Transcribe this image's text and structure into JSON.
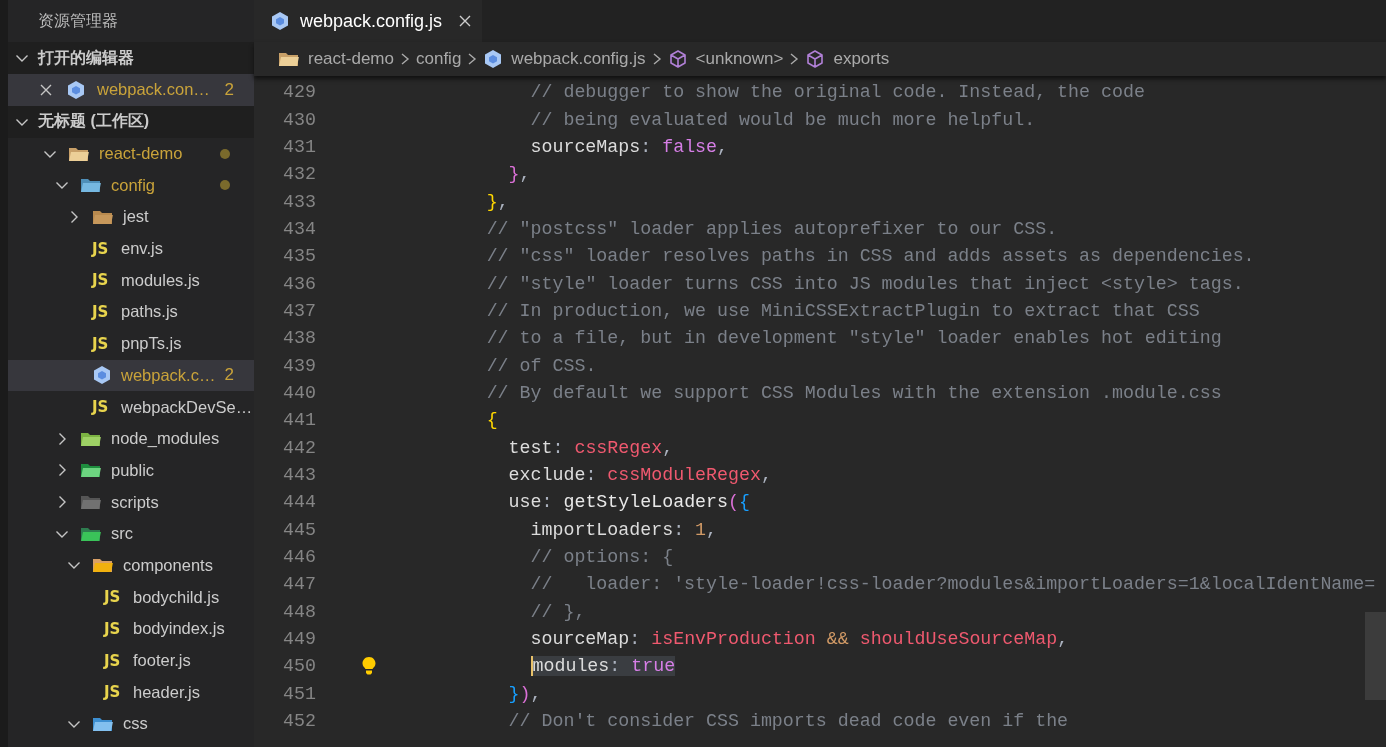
{
  "sidebar": {
    "title": "资源管理器",
    "sections": [
      {
        "kind": "open-editors",
        "title": "打开的编辑器",
        "expanded": true,
        "items": [
          {
            "label": "webpack.con…",
            "kind": "webpack",
            "selected": true,
            "modified": true,
            "badge": "2"
          }
        ]
      },
      {
        "kind": "tree",
        "title": "无标题 (工作区)",
        "expanded": true,
        "items": [
          {
            "label": "react-demo",
            "kind": "folder-react",
            "expanded": true,
            "selected": false,
            "modified": true,
            "children": [
              {
                "label": "config",
                "kind": "folder-config",
                "expanded": true,
                "selected": false,
                "modified": true,
                "children": [
                  {
                    "label": "jest",
                    "kind": "folder",
                    "expanded": false,
                    "selected": false,
                    "modified": false
                  },
                  {
                    "label": "env.js",
                    "kind": "js",
                    "icon_label": "JS",
                    "selected": false,
                    "modified": false
                  },
                  {
                    "label": "modules.js",
                    "kind": "js",
                    "icon_label": "JS",
                    "selected": false,
                    "modified": false
                  },
                  {
                    "label": "paths.js",
                    "kind": "js",
                    "icon_label": "JS",
                    "selected": false,
                    "modified": false
                  },
                  {
                    "label": "pnpTs.js",
                    "kind": "js",
                    "icon_label": "JS",
                    "selected": false,
                    "modified": false
                  },
                  {
                    "label": "webpack.c…",
                    "kind": "webpack",
                    "selected": true,
                    "modified": true,
                    "badge": "2"
                  },
                  {
                    "label": "webpackDevSe…",
                    "kind": "js",
                    "icon_label": "JS",
                    "selected": false,
                    "modified": false
                  }
                ]
              },
              {
                "label": "node_modules",
                "kind": "folder-node",
                "expanded": false,
                "selected": false,
                "modified": false
              },
              {
                "label": "public",
                "kind": "folder-public",
                "expanded": false,
                "selected": false,
                "modified": false
              },
              {
                "label": "scripts",
                "kind": "folder-scripts",
                "expanded": false,
                "selected": false,
                "modified": false
              },
              {
                "label": "src",
                "kind": "folder-src",
                "expanded": true,
                "selected": false,
                "modified": false,
                "children": [
                  {
                    "label": "components",
                    "kind": "folder-components",
                    "expanded": true,
                    "selected": false,
                    "modified": false,
                    "children": [
                      {
                        "label": "bodychild.js",
                        "kind": "js",
                        "icon_label": "JS",
                        "selected": false,
                        "modified": false
                      },
                      {
                        "label": "bodyindex.js",
                        "kind": "js",
                        "icon_label": "JS",
                        "selected": false,
                        "modified": false
                      },
                      {
                        "label": "footer.js",
                        "kind": "js",
                        "icon_label": "JS",
                        "selected": false,
                        "modified": false
                      },
                      {
                        "label": "header.js",
                        "kind": "js",
                        "icon_label": "JS",
                        "selected": false,
                        "modified": false
                      }
                    ]
                  },
                  {
                    "label": "css",
                    "kind": "folder-css",
                    "expanded": true,
                    "selected": false,
                    "modified": false
                  }
                ]
              }
            ]
          }
        ]
      }
    ]
  },
  "tabs": [
    {
      "label": "webpack.config.js",
      "kind": "webpack",
      "selected": true
    }
  ],
  "breadcrumbs": [
    {
      "label": "react-demo",
      "kind": "folder-react"
    },
    {
      "label": "config",
      "kind": "plain"
    },
    {
      "label": "webpack.config.js",
      "kind": "webpack"
    },
    {
      "label": "<unknown>",
      "kind": "symbol"
    },
    {
      "label": "exports",
      "kind": "symbol"
    }
  ],
  "editor": {
    "lines": [
      {
        "number": "429",
        "current": false,
        "tokens": [
          {
            "kind": "comment",
            "text": "                // debugger to show the original code. Instead, the code"
          }
        ]
      },
      {
        "number": "430",
        "current": false,
        "tokens": [
          {
            "kind": "comment",
            "text": "                // being evaluated would be much more helpful."
          }
        ]
      },
      {
        "number": "431",
        "current": false,
        "tokens": [
          {
            "kind": "prop",
            "text": "                sourceMaps"
          },
          {
            "kind": "punct",
            "text": ": "
          },
          {
            "kind": "keyword",
            "text": "false"
          },
          {
            "kind": "punct",
            "text": ","
          }
        ]
      },
      {
        "number": "432",
        "current": false,
        "tokens": [
          {
            "kind": "brace2",
            "text": "              }"
          },
          {
            "kind": "punct",
            "text": ","
          }
        ]
      },
      {
        "number": "433",
        "current": false,
        "tokens": [
          {
            "kind": "brace1",
            "text": "            }"
          },
          {
            "kind": "punct",
            "text": ","
          }
        ]
      },
      {
        "number": "434",
        "current": false,
        "tokens": [
          {
            "kind": "comment",
            "text": "            // \"postcss\" loader applies autoprefixer to our CSS."
          }
        ]
      },
      {
        "number": "435",
        "current": false,
        "tokens": [
          {
            "kind": "comment",
            "text": "            // \"css\" loader resolves paths in CSS and adds assets as dependencies."
          }
        ]
      },
      {
        "number": "436",
        "current": false,
        "tokens": [
          {
            "kind": "comment",
            "text": "            // \"style\" loader turns CSS into JS modules that inject <style> tags."
          }
        ]
      },
      {
        "number": "437",
        "current": false,
        "tokens": [
          {
            "kind": "comment",
            "text": "            // In production, we use MiniCSSExtractPlugin to extract that CSS"
          }
        ]
      },
      {
        "number": "438",
        "current": false,
        "tokens": [
          {
            "kind": "comment",
            "text": "            // to a file, but in development \"style\" loader enables hot editing"
          }
        ]
      },
      {
        "number": "439",
        "current": false,
        "tokens": [
          {
            "kind": "comment",
            "text": "            // of CSS."
          }
        ]
      },
      {
        "number": "440",
        "current": false,
        "tokens": [
          {
            "kind": "comment",
            "text": "            // By default we support CSS Modules with the extension .module.css"
          }
        ]
      },
      {
        "number": "441",
        "current": false,
        "tokens": [
          {
            "kind": "brace1",
            "text": "            {"
          }
        ]
      },
      {
        "number": "442",
        "current": false,
        "tokens": [
          {
            "kind": "prop",
            "text": "              test"
          },
          {
            "kind": "punct",
            "text": ": "
          },
          {
            "kind": "var",
            "text": "cssRegex"
          },
          {
            "kind": "punct",
            "text": ","
          }
        ]
      },
      {
        "number": "443",
        "current": false,
        "tokens": [
          {
            "kind": "prop",
            "text": "              exclude"
          },
          {
            "kind": "punct",
            "text": ": "
          },
          {
            "kind": "var",
            "text": "cssModuleRegex"
          },
          {
            "kind": "punct",
            "text": ","
          }
        ]
      },
      {
        "number": "444",
        "current": false,
        "tokens": [
          {
            "kind": "prop",
            "text": "              use"
          },
          {
            "kind": "punct",
            "text": ": "
          },
          {
            "kind": "func",
            "text": "getStyleLoaders"
          },
          {
            "kind": "brace2",
            "text": "("
          },
          {
            "kind": "brace3",
            "text": "{"
          }
        ]
      },
      {
        "number": "445",
        "current": false,
        "tokens": [
          {
            "kind": "prop",
            "text": "                importLoaders"
          },
          {
            "kind": "punct",
            "text": ": "
          },
          {
            "kind": "num",
            "text": "1"
          },
          {
            "kind": "punct",
            "text": ","
          }
        ]
      },
      {
        "number": "446",
        "current": false,
        "tokens": [
          {
            "kind": "comment",
            "text": "                // options: {"
          }
        ]
      },
      {
        "number": "447",
        "current": false,
        "tokens": [
          {
            "kind": "comment",
            "text": "                //   loader: 'style-loader!css-loader?modules&importLoaders=1&localIdentName="
          }
        ]
      },
      {
        "number": "448",
        "current": false,
        "tokens": [
          {
            "kind": "comment",
            "text": "                // },"
          }
        ]
      },
      {
        "number": "449",
        "current": false,
        "tokens": [
          {
            "kind": "prop",
            "text": "                sourceMap"
          },
          {
            "kind": "punct",
            "text": ": "
          },
          {
            "kind": "var",
            "text": "isEnvProduction"
          },
          {
            "kind": "op",
            "text": " && "
          },
          {
            "kind": "var",
            "text": "shouldUseSourceMap"
          },
          {
            "kind": "punct",
            "text": ","
          }
        ]
      },
      {
        "number": "450",
        "current": true,
        "tokens": [
          {
            "kind": "prop",
            "text": "                modules"
          },
          {
            "kind": "punct",
            "text": ": "
          },
          {
            "kind": "keyword",
            "text": "true"
          }
        ]
      },
      {
        "number": "451",
        "current": false,
        "tokens": [
          {
            "kind": "brace3",
            "text": "              }"
          },
          {
            "kind": "brace2",
            "text": ")"
          },
          {
            "kind": "punct",
            "text": ","
          }
        ]
      },
      {
        "number": "452",
        "current": false,
        "tokens": [
          {
            "kind": "comment",
            "text": "              // Don't consider CSS imports dead code even if the"
          }
        ]
      }
    ]
  }
}
